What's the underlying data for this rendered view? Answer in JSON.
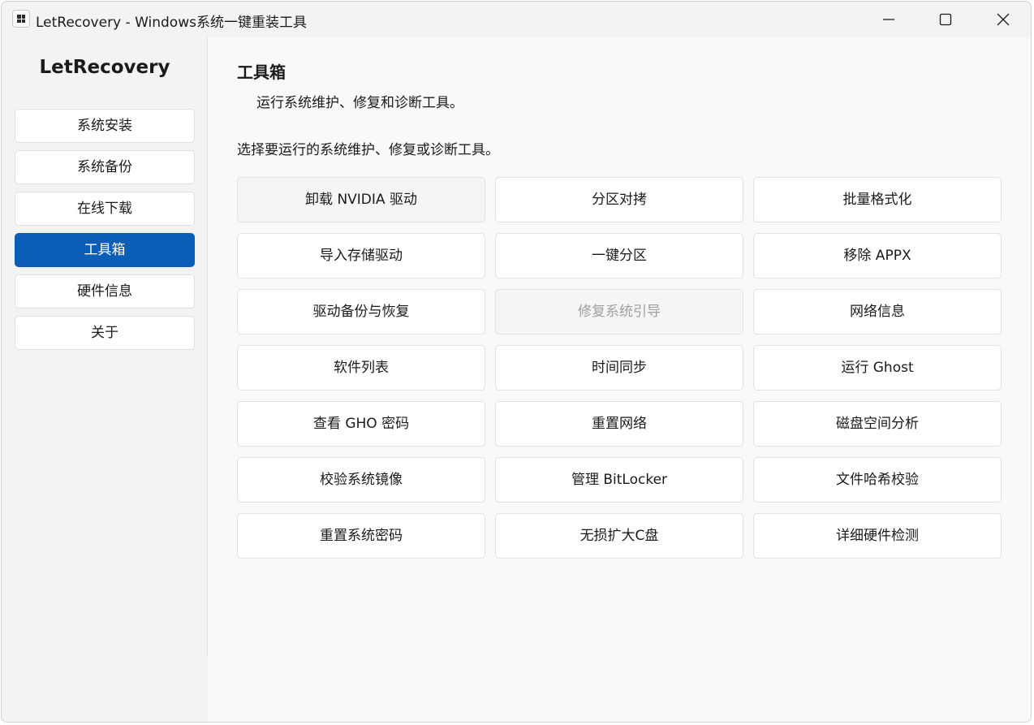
{
  "window": {
    "title": "LetRecovery - Windows系统一键重装工具"
  },
  "sidebar": {
    "brand": "LetRecovery",
    "items": [
      {
        "label": "系统安装",
        "active": false
      },
      {
        "label": "系统备份",
        "active": false
      },
      {
        "label": "在线下载",
        "active": false
      },
      {
        "label": "工具箱",
        "active": true
      },
      {
        "label": "硬件信息",
        "active": false
      },
      {
        "label": "关于",
        "active": false
      }
    ]
  },
  "main": {
    "title": "工具箱",
    "subtitle": "运行系统维护、修复和诊断工具。",
    "description": "选择要运行的系统维护、修复或诊断工具。",
    "tools": [
      {
        "label": "卸载 NVIDIA 驱动",
        "state": "hover"
      },
      {
        "label": "分区对拷",
        "state": "normal"
      },
      {
        "label": "批量格式化",
        "state": "normal"
      },
      {
        "label": "导入存储驱动",
        "state": "normal"
      },
      {
        "label": "一键分区",
        "state": "normal"
      },
      {
        "label": "移除 APPX",
        "state": "normal"
      },
      {
        "label": "驱动备份与恢复",
        "state": "normal"
      },
      {
        "label": "修复系统引导",
        "state": "disabled"
      },
      {
        "label": "网络信息",
        "state": "normal"
      },
      {
        "label": "软件列表",
        "state": "normal"
      },
      {
        "label": "时间同步",
        "state": "normal"
      },
      {
        "label": "运行 Ghost",
        "state": "normal"
      },
      {
        "label": "查看 GHO 密码",
        "state": "normal"
      },
      {
        "label": "重置网络",
        "state": "normal"
      },
      {
        "label": "磁盘空间分析",
        "state": "normal"
      },
      {
        "label": "校验系统镜像",
        "state": "normal"
      },
      {
        "label": "管理 BitLocker",
        "state": "normal"
      },
      {
        "label": "文件哈希校验",
        "state": "normal"
      },
      {
        "label": "重置系统密码",
        "state": "normal"
      },
      {
        "label": "无损扩大C盘",
        "state": "normal"
      },
      {
        "label": "详细硬件检测",
        "state": "normal"
      }
    ]
  },
  "colors": {
    "accent": "#0a5eb8",
    "disabled_text": "#a0a0a0"
  }
}
